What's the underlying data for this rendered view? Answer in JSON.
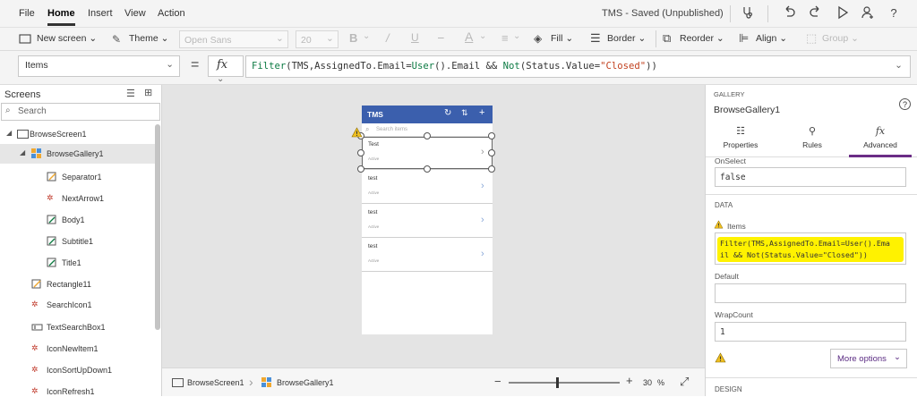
{
  "menubar": {
    "items": [
      "File",
      "Home",
      "Insert",
      "View",
      "Action"
    ],
    "doc_title": "TMS - Saved (Unpublished)"
  },
  "toolbar": {
    "new_screen": "New screen",
    "theme": "Theme",
    "font": "Open Sans",
    "size": "20",
    "fill": "Fill",
    "border": "Border",
    "reorder": "Reorder",
    "align": "Align",
    "group": "Group"
  },
  "formula": {
    "property": "Items",
    "eq": "=",
    "fx": "fx",
    "p1": "Filter",
    "p2": "(TMS,AssignedTo.Email=",
    "p3": "User",
    "p4": "().Email && ",
    "p5": "Not",
    "p6": "(Status.Value=",
    "p7": "\"Closed\"",
    "p8": "))"
  },
  "left": {
    "title": "Screens",
    "search_placeholder": "Search",
    "tree": [
      {
        "label": "BrowseScreen1",
        "icon": "screen-icon"
      },
      {
        "label": "BrowseGallery1",
        "icon": "gallery-icon"
      },
      {
        "label": "Separator1",
        "icon": "shape-icon"
      },
      {
        "label": "NextArrow1",
        "icon": "icon-control-icon"
      },
      {
        "label": "Body1",
        "icon": "label-icon"
      },
      {
        "label": "Subtitle1",
        "icon": "label-icon"
      },
      {
        "label": "Title1",
        "icon": "label-icon"
      },
      {
        "label": "Rectangle11",
        "icon": "shape-icon"
      },
      {
        "label": "SearchIcon1",
        "icon": "icon-control-icon"
      },
      {
        "label": "TextSearchBox1",
        "icon": "textinput-icon"
      },
      {
        "label": "IconNewItem1",
        "icon": "icon-control-icon"
      },
      {
        "label": "IconSortUpDown1",
        "icon": "icon-control-icon"
      },
      {
        "label": "IconRefresh1",
        "icon": "icon-control-icon"
      }
    ]
  },
  "phone": {
    "app_title": "TMS",
    "search_placeholder": "Search items",
    "items": [
      {
        "title": "Test",
        "subtitle": "Active"
      },
      {
        "title": "test",
        "subtitle": "Active"
      },
      {
        "title": "test",
        "subtitle": "Active"
      },
      {
        "title": "test",
        "subtitle": "Active"
      }
    ],
    "header_color": "#3b5fad"
  },
  "status": {
    "crumb1": "BrowseScreen1",
    "crumb2": "BrowseGallery1",
    "zoom": "30",
    "zoom_unit": "%",
    "zoom_level": 0.3
  },
  "right": {
    "kind": "GALLERY",
    "name": "BrowseGallery1",
    "tabs": [
      "Properties",
      "Rules",
      "Advanced"
    ],
    "onselect_label": "OnSelect",
    "onselect_value": "false",
    "data_heading": "DATA",
    "items_label": "Items",
    "items_line1": "Filter(TMS,AssignedTo.Email=User().Ema",
    "items_line2": "il && Not(Status.Value=\"Closed\"))",
    "default_label": "Default",
    "default_value": "",
    "wrapcount_label": "WrapCount",
    "wrapcount_value": "1",
    "more_options": "More options",
    "design_heading": "DESIGN",
    "highlight_color": "#fff200"
  }
}
